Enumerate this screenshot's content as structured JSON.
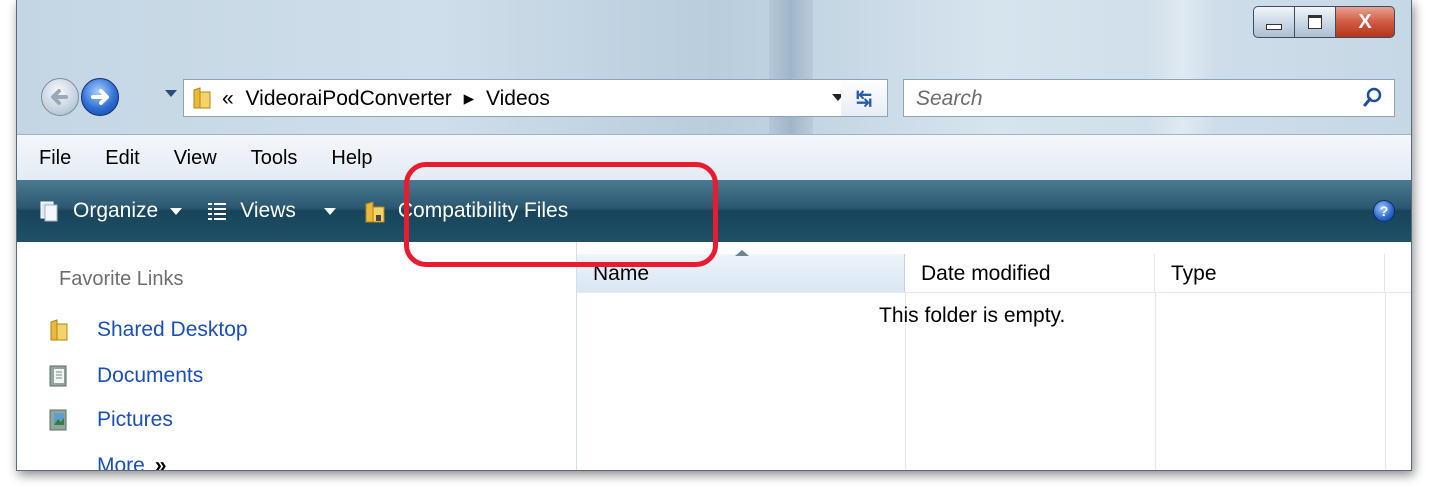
{
  "window": {
    "controls": {
      "minimize": "minimize",
      "maximize": "maximize",
      "close": "X"
    }
  },
  "address": {
    "prefix": "«",
    "path": [
      "VideoraiPodConverter",
      "Videos"
    ],
    "separator": "▸"
  },
  "search": {
    "placeholder": "Search"
  },
  "menu": [
    "File",
    "Edit",
    "View",
    "Tools",
    "Help"
  ],
  "toolbar": {
    "organize_label": "Organize",
    "views_label": "Views",
    "compat_label": "Compatibility Files",
    "help_label": "?"
  },
  "nav_pane": {
    "title": "Favorite Links",
    "links": [
      "Shared Desktop",
      "Documents",
      "Pictures"
    ],
    "more_label": "More",
    "more_chevron": "»"
  },
  "file_list": {
    "columns": [
      "Name",
      "Date modified",
      "Type"
    ],
    "empty_message": "This folder is empty."
  },
  "colors": {
    "link": "#1a4fb5",
    "command_bar": "#2b5870",
    "highlight": "#ea1b2e"
  }
}
